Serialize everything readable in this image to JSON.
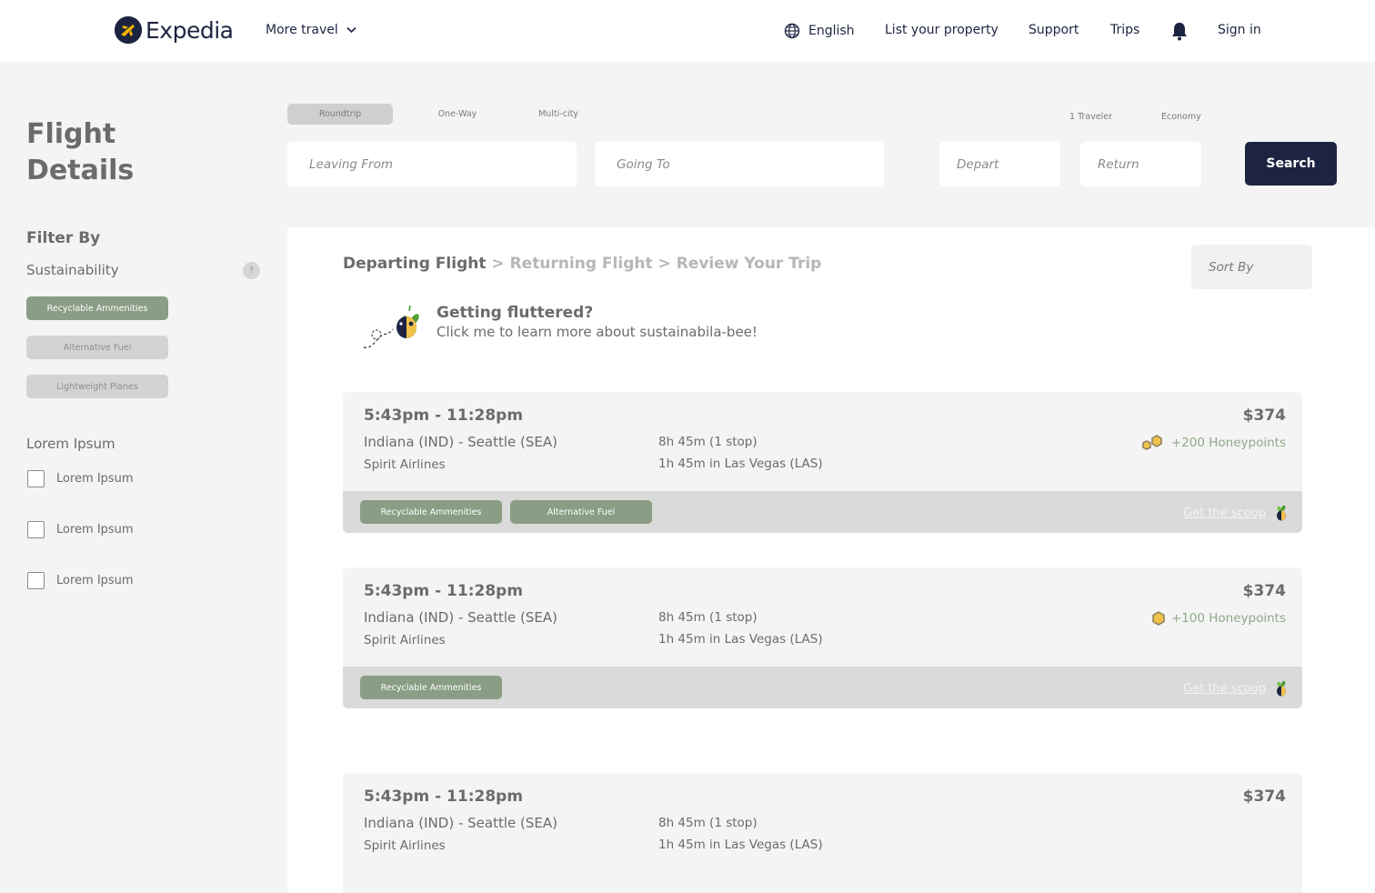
{
  "header": {
    "brand": "Expedia",
    "more_travel": "More travel",
    "language": "English",
    "list_property": "List your property",
    "support": "Support",
    "trips": "Trips",
    "sign_in": "Sign in"
  },
  "sidebar": {
    "title": "Flight Details",
    "filter_heading": "Filter By",
    "sustainability_label": "Sustainability",
    "help_badge": "?",
    "chips": [
      {
        "label": "Recyclable Ammenities",
        "active": true
      },
      {
        "label": "Alternative Fuel",
        "active": false
      },
      {
        "label": "Lightweight Planes",
        "active": false
      }
    ],
    "lorem_heading": "Lorem Ipsum",
    "checkboxes": [
      {
        "label": "Lorem Ipsum",
        "checked": false
      },
      {
        "label": "Lorem Ipsum",
        "checked": false
      },
      {
        "label": "Lorem Ipsum",
        "checked": false
      }
    ]
  },
  "search": {
    "trip_types": [
      "Roundtrip",
      "One-Way",
      "Multi-city"
    ],
    "active_trip_type": "Roundtrip",
    "travelers": "1 Traveler",
    "cabin": "Economy",
    "leaving_from_placeholder": "Leaving From",
    "going_to_placeholder": "Going To",
    "depart_placeholder": "Depart",
    "return_placeholder": "Return",
    "button": "Search"
  },
  "results": {
    "breadcrumb": {
      "step1": "Departing Flight",
      "step2": "Returning Flight",
      "step3": "Review Your Trip",
      "separator": ">"
    },
    "sort_by_placeholder": "Sort By",
    "promo": {
      "title": "Getting fluttered?",
      "subtitle": "Click me to learn more about sustainabila-bee!"
    },
    "flights": [
      {
        "time": "5:43pm - 11:28pm",
        "route": "Indiana (IND) - Seattle (SEA)",
        "airline": "Spirit Airlines",
        "duration": "8h 45m (1 stop)",
        "layover": "1h 45m in Las Vegas (LAS)",
        "price": "$374",
        "points": "+200 Honeypoints",
        "tags": [
          "Recyclable Ammenities",
          "Alternative Fuel"
        ],
        "scoop": "Get the scoop"
      },
      {
        "time": "5:43pm - 11:28pm",
        "route": "Indiana (IND) - Seattle (SEA)",
        "airline": "Spirit Airlines",
        "duration": "8h 45m (1 stop)",
        "layover": "1h 45m in Las Vegas (LAS)",
        "price": "$374",
        "points": "+100 Honeypoints",
        "tags": [
          "Recyclable Ammenities"
        ],
        "scoop": "Get the scoop"
      },
      {
        "time": "5:43pm - 11:28pm",
        "route": "Indiana (IND) - Seattle (SEA)",
        "airline": "Spirit Airlines",
        "duration": "8h 45m (1 stop)",
        "layover": "1h 45m in Las Vegas (LAS)",
        "price": "$374"
      }
    ]
  },
  "icons": {
    "logo": "expedia-plane-logo-icon",
    "chevron": "chevron-down-icon",
    "globe": "globe-icon",
    "bell": "bell-icon",
    "bee": "bee-mascot-icon",
    "honeycomb": "honeycomb-icon"
  },
  "colors": {
    "brand_navy": "#1d2441",
    "chip_green": "#8a9d85",
    "points_green": "#8fa989",
    "honey_yellow": "#f0c14b"
  }
}
